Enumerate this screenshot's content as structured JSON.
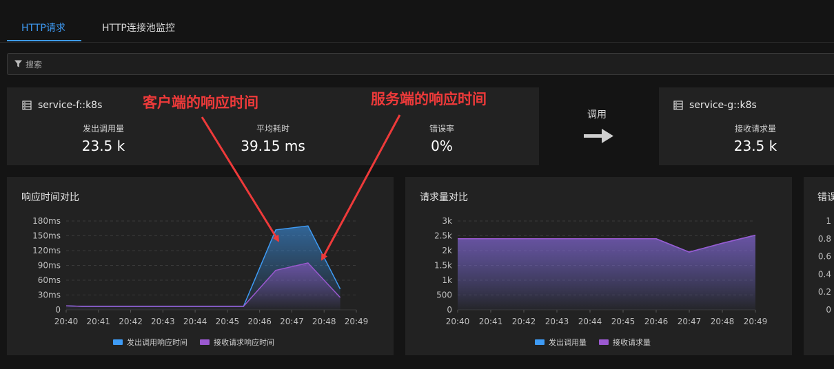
{
  "tabs": [
    {
      "label": "HTTP请求",
      "active": true
    },
    {
      "label": "HTTP连接池监控",
      "active": false
    }
  ],
  "search": {
    "placeholder": "搜索",
    "value": ""
  },
  "caller": {
    "name": "service-f::k8s",
    "stats": [
      {
        "label": "发出调用量",
        "value": "23.5 k"
      },
      {
        "label": "平均耗时",
        "value": "39.15 ms"
      },
      {
        "label": "错误率",
        "value": "0%"
      }
    ]
  },
  "call_label": "调用",
  "callee": {
    "name": "service-g::k8s",
    "stats": [
      {
        "label": "接收请求量",
        "value": "23.5 k"
      }
    ]
  },
  "annotations": {
    "client": "客户端的响应时间",
    "server": "服务端的响应时间"
  },
  "colors": {
    "blue": "#3e9bf5",
    "purple": "#9b59d0",
    "annotation": "#ee3a3a",
    "tab_active": "#3e9bf5"
  },
  "panels": {
    "response": {
      "title": "响应时间对比"
    },
    "requests": {
      "title": "请求量对比"
    },
    "errors": {
      "title": "错误"
    }
  },
  "chart_data": [
    {
      "type": "area",
      "title": "响应时间对比",
      "categories": [
        "20:40",
        "20:41",
        "20:42",
        "20:43",
        "20:44",
        "20:45",
        "20:46",
        "20:47",
        "20:48",
        "20:49"
      ],
      "x": [
        20.5,
        21,
        22,
        23,
        24,
        25,
        26,
        27,
        28,
        29
      ],
      "ylim": [
        0,
        180
      ],
      "yticks": [
        "0",
        "30ms",
        "60ms",
        "90ms",
        "120ms",
        "150ms",
        "180ms"
      ],
      "series": [
        {
          "name": "发出调用响应时间",
          "color": "#3e9bf5",
          "values": [
            8,
            7,
            7,
            7,
            7,
            7,
            7,
            162,
            170,
            42
          ]
        },
        {
          "name": "接收请求响应时间",
          "color": "#9b59d0",
          "values": [
            8,
            7,
            7,
            7,
            7,
            7,
            7,
            80,
            95,
            25
          ]
        }
      ]
    },
    {
      "type": "area",
      "title": "请求量对比",
      "categories": [
        "20:40",
        "20:41",
        "20:42",
        "20:43",
        "20:44",
        "20:45",
        "20:46",
        "20:47",
        "20:48",
        "20:49"
      ],
      "x": [
        0,
        1,
        2,
        3,
        4,
        5,
        6,
        7,
        8,
        9
      ],
      "ylim": [
        0,
        3000
      ],
      "yticks": [
        "0",
        "500",
        "1k",
        "1.5k",
        "2k",
        "2.5k",
        "3k"
      ],
      "series": [
        {
          "name": "发出调用量",
          "color": "#3e9bf5",
          "values": [
            2400,
            2400,
            2400,
            2400,
            2400,
            2400,
            2400,
            1950,
            2250,
            2520
          ]
        },
        {
          "name": "接收请求量",
          "color": "#9b59d0",
          "values": [
            2400,
            2400,
            2400,
            2400,
            2400,
            2400,
            2400,
            1950,
            2250,
            2520
          ]
        }
      ]
    },
    {
      "type": "line",
      "title": "错误",
      "ylim": [
        0,
        1
      ],
      "yticks": [
        "0",
        "0.2",
        "0.4",
        "0.6",
        "0.8",
        "1"
      ]
    }
  ]
}
